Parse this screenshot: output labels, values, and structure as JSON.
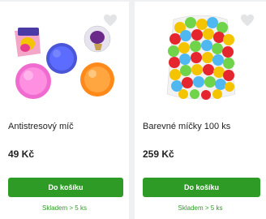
{
  "products": [
    {
      "name": "Antistresový míč",
      "price": "49 Kč",
      "button_label": "Do košíku",
      "stock": "Skladem > 5 ks"
    },
    {
      "name": "Barevné míčky 100 ks",
      "price": "259 Kč",
      "button_label": "Do košíku",
      "stock": "Skladem > 5 ks"
    }
  ],
  "colors": {
    "accent": "#2f9b27",
    "background": "#eef0f1",
    "card": "#ffffff"
  },
  "icons": [
    "heart-icon"
  ]
}
